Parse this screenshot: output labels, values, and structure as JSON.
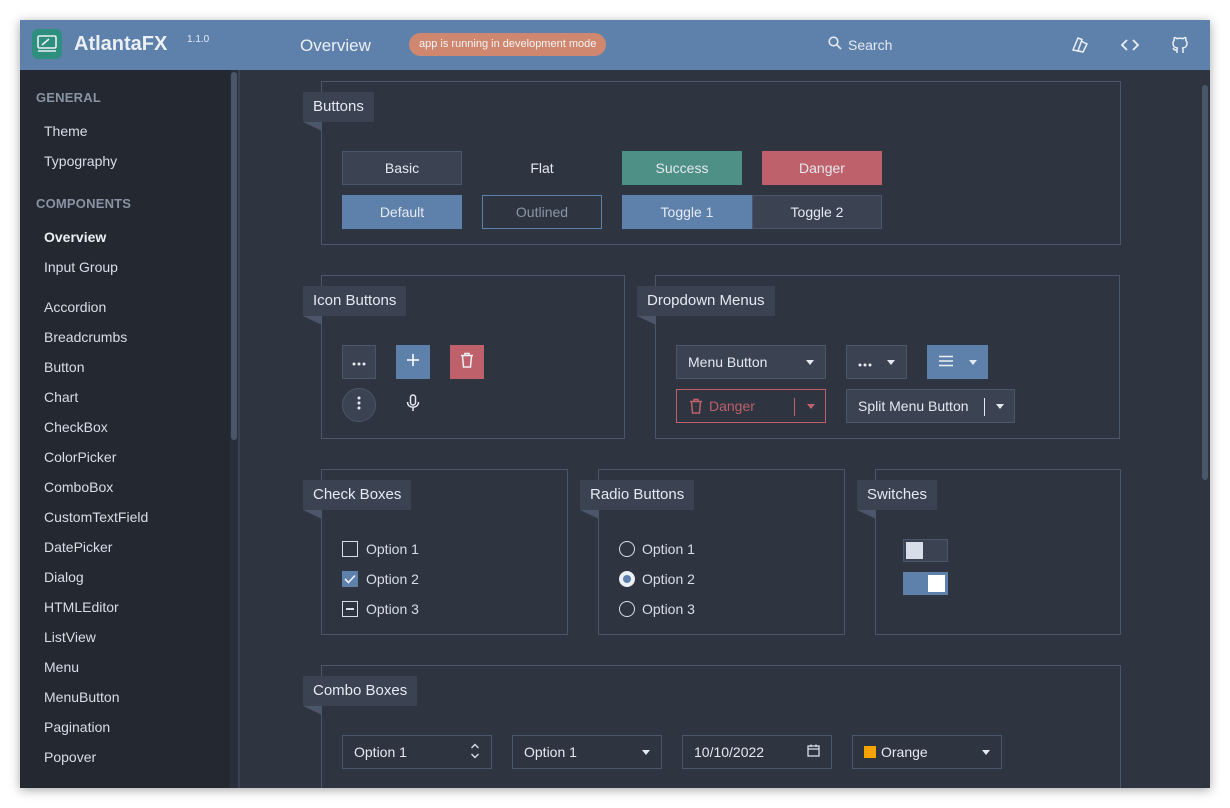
{
  "header": {
    "app_name": "AtlantaFX",
    "version": "1.1.0",
    "page_title": "Overview",
    "dev_badge": "app is running in development mode",
    "search_label": "Search",
    "colors": {
      "bar": "#5e81ac",
      "badge": "#d08770"
    }
  },
  "sidebar": {
    "groups": [
      {
        "title": "GENERAL",
        "items": [
          "Theme",
          "Typography"
        ]
      },
      {
        "title": "COMPONENTS",
        "items": [
          "Overview",
          "Input Group",
          "Accordion",
          "Breadcrumbs",
          "Button",
          "Chart",
          "CheckBox",
          "ColorPicker",
          "ComboBox",
          "CustomTextField",
          "DatePicker",
          "Dialog",
          "HTMLEditor",
          "ListView",
          "Menu",
          "MenuButton",
          "Pagination",
          "Popover"
        ]
      }
    ],
    "selected": "Overview"
  },
  "buttons": {
    "title": "Buttons",
    "basic": "Basic",
    "flat": "Flat",
    "success": "Success",
    "danger": "Danger",
    "default": "Default",
    "outlined": "Outlined",
    "toggle1": "Toggle 1",
    "toggle2": "Toggle 2",
    "selected_toggle": "Toggle 1"
  },
  "icon_buttons": {
    "title": "Icon Buttons",
    "icons": [
      "ellipsis-icon",
      "plus-icon",
      "trash-icon",
      "vertical-dots-icon",
      "microphone-icon"
    ]
  },
  "dropdown_menus": {
    "title": "Dropdown Menus",
    "menu_button": "Menu Button",
    "danger": "Danger",
    "split_menu_button": "Split Menu Button"
  },
  "check_boxes": {
    "title": "Check Boxes",
    "options": [
      {
        "label": "Option 1",
        "state": "unchecked"
      },
      {
        "label": "Option 2",
        "state": "checked"
      },
      {
        "label": "Option 3",
        "state": "indeterminate"
      }
    ]
  },
  "radio_buttons": {
    "title": "Radio Buttons",
    "options": [
      "Option 1",
      "Option 2",
      "Option 3"
    ],
    "selected": "Option 2"
  },
  "switches": {
    "title": "Switches",
    "states": [
      false,
      true
    ]
  },
  "combo_boxes": {
    "title": "Combo Boxes",
    "spinner_value": "Option 1",
    "combo_value": "Option 1",
    "date_value": "10/10/2022",
    "color_value": "Orange",
    "color_swatch": "#f5a300"
  }
}
